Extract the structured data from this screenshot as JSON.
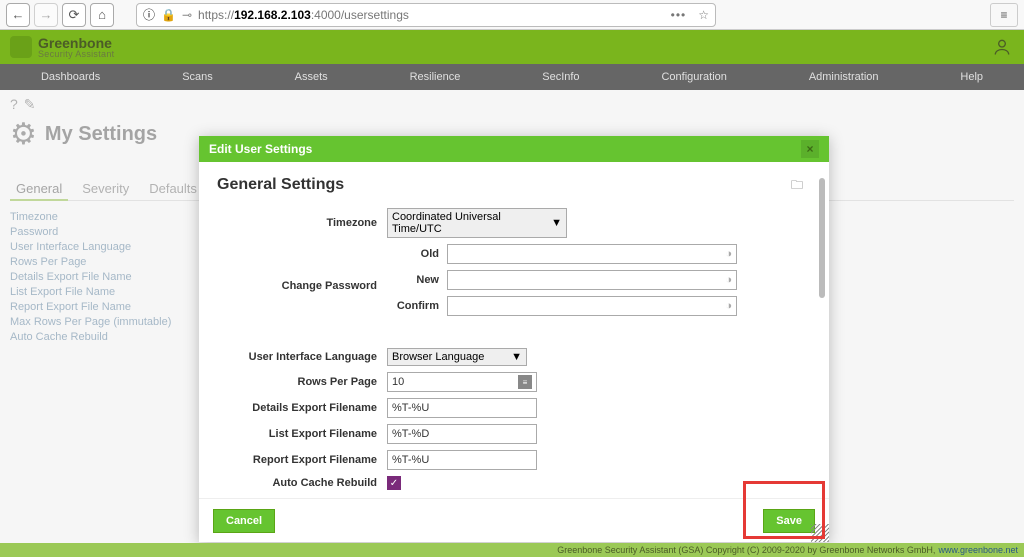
{
  "browser": {
    "url_prefix": "https://",
    "url_bold": "192.168.2.103",
    "url_suffix": ":4000/usersettings"
  },
  "brand": {
    "line1": "Greenbone",
    "line2": "Security Assistant"
  },
  "nav": {
    "dashboards": "Dashboards",
    "scans": "Scans",
    "assets": "Assets",
    "resilience": "Resilience",
    "secinfo": "SecInfo",
    "configuration": "Configuration",
    "administration": "Administration",
    "help": "Help"
  },
  "page": {
    "title": "My Settings",
    "tabs": {
      "general": "General",
      "severity": "Severity",
      "defaults": "Defaults"
    },
    "settings": [
      "Timezone",
      "Password",
      "User Interface Language",
      "Rows Per Page",
      "Details Export File Name",
      "List Export File Name",
      "Report Export File Name",
      "Max Rows Per Page (immutable)",
      "Auto Cache Rebuild"
    ]
  },
  "modal": {
    "title": "Edit User Settings",
    "section": "General Settings",
    "labels": {
      "timezone": "Timezone",
      "change_password": "Change Password",
      "old": "Old",
      "new": "New",
      "confirm": "Confirm",
      "ui_lang": "User Interface Language",
      "rows": "Rows Per Page",
      "details_fn": "Details Export Filename",
      "list_fn": "List Export Filename",
      "report_fn": "Report Export Filename",
      "auto_cache": "Auto Cache Rebuild"
    },
    "values": {
      "timezone": "Coordinated Universal Time/UTC",
      "ui_lang": "Browser Language",
      "rows": "10",
      "details_fn": "%T-%U",
      "list_fn": "%T-%D",
      "report_fn": "%T-%U"
    },
    "buttons": {
      "cancel": "Cancel",
      "save": "Save"
    }
  },
  "footer": {
    "text": "Greenbone Security Assistant (GSA) Copyright (C) 2009-2020 by Greenbone Networks GmbH,",
    "link": "www.greenbone.net"
  }
}
